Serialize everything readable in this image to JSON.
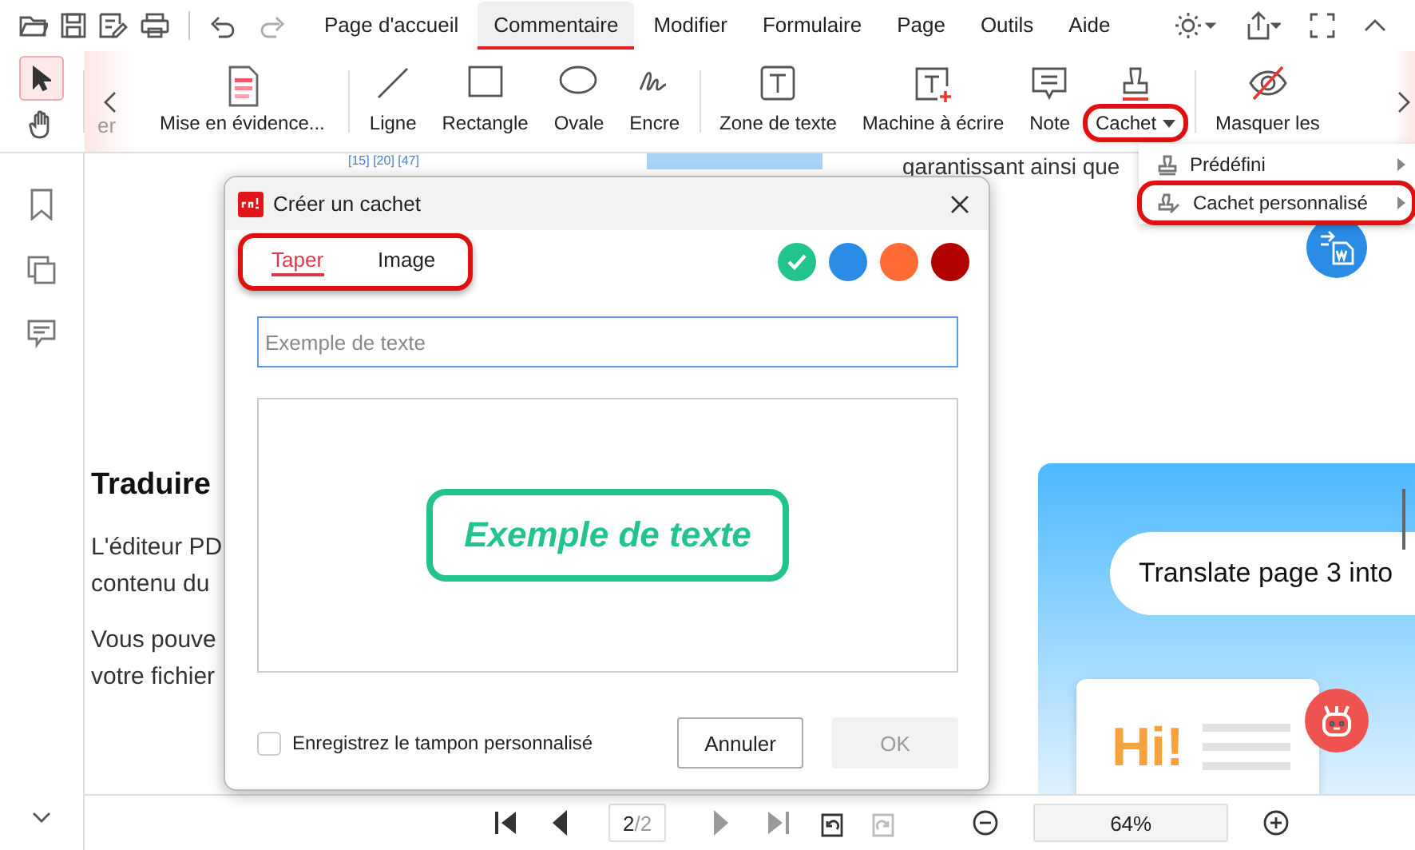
{
  "menubar": {
    "tabs": [
      {
        "label": "Page d'accueil",
        "selected": false
      },
      {
        "label": "Commentaire",
        "selected": true
      },
      {
        "label": "Modifier",
        "selected": false
      },
      {
        "label": "Formulaire",
        "selected": false
      },
      {
        "label": "Page",
        "selected": false
      },
      {
        "label": "Outils",
        "selected": false
      },
      {
        "label": "Aide",
        "selected": false
      }
    ]
  },
  "toolbar": {
    "pointer_tools": [
      {
        "kind": "select",
        "selected": true
      },
      {
        "kind": "hand",
        "selected": false
      }
    ],
    "cut_label": "er",
    "tools": [
      {
        "kind": "highlight",
        "label": "Mise en évidence...",
        "highlighted": false
      },
      {
        "kind": "line",
        "label": "Ligne",
        "highlighted": false
      },
      {
        "kind": "rectangle",
        "label": "Rectangle",
        "highlighted": false
      },
      {
        "kind": "oval",
        "label": "Ovale",
        "highlighted": false
      },
      {
        "kind": "ink",
        "label": "Encre",
        "highlighted": false
      },
      {
        "kind": "textbox",
        "label": "Zone de texte",
        "highlighted": false
      },
      {
        "kind": "typewriter",
        "label": "Machine à écrire",
        "highlighted": false
      },
      {
        "kind": "note",
        "label": "Note",
        "highlighted": false
      },
      {
        "kind": "stamp",
        "label": "Cachet",
        "highlighted": true
      },
      {
        "kind": "hide",
        "label": "Masquer les",
        "highlighted": false
      }
    ]
  },
  "stamp_menu": {
    "items": [
      {
        "kind": "predefined",
        "label": "Prédéfini",
        "highlighted": false
      },
      {
        "kind": "custom",
        "label": "Cachet personnalisé",
        "highlighted": true
      }
    ]
  },
  "document": {
    "citations": "[15] [20] [47]",
    "top_line": "garantissant ainsi que",
    "heading": "Traduire",
    "paragraphs": [
      [
        "L'éditeur PD",
        "contenu du"
      ],
      [
        "Vous pouve",
        "votre fichier"
      ]
    ],
    "card": {
      "prompt": "Translate page 3 into",
      "greeting": "Hi!"
    }
  },
  "dialog": {
    "title": "Créer un cachet",
    "tabs_highlighted": true,
    "tabs": [
      {
        "label": "Taper",
        "selected": true
      },
      {
        "label": "Image",
        "selected": false
      }
    ],
    "colors": [
      {
        "color": "#22c38e",
        "selected": true
      },
      {
        "color": "#2b8ce6",
        "selected": false
      },
      {
        "color": "#ff6b35",
        "selected": false
      },
      {
        "color": "#b00000",
        "selected": false
      }
    ],
    "input": {
      "placeholder": "Exemple de texte"
    },
    "preview": "Exemple de texte",
    "save_checkbox": {
      "label": "Enregistrez le tampon personnalisé",
      "checked": false
    },
    "buttons": [
      {
        "label": "Annuler",
        "disabled": false
      },
      {
        "label": "OK",
        "disabled": true
      }
    ]
  },
  "statusbar": {
    "page_current": "2",
    "page_total": "/2",
    "zoom": "64%"
  }
}
